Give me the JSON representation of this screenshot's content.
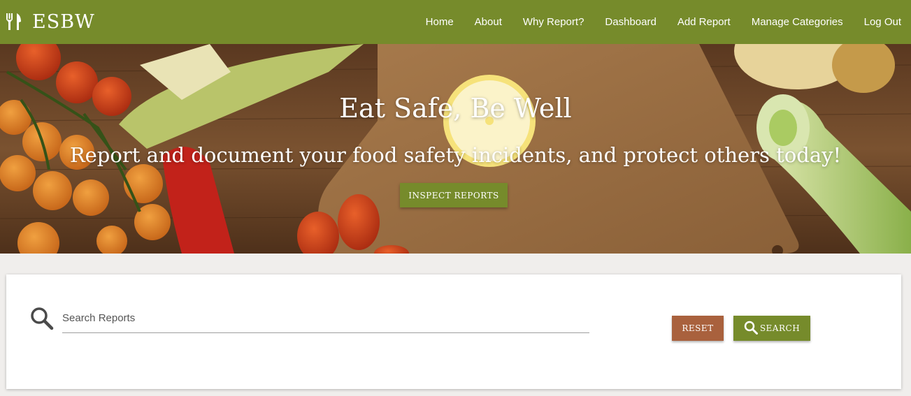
{
  "brand": {
    "name": "ESBW",
    "icon": "fork-knife-icon"
  },
  "nav": {
    "items": [
      {
        "label": "Home"
      },
      {
        "label": "About"
      },
      {
        "label": "Why Report?"
      },
      {
        "label": "Dashboard"
      },
      {
        "label": "Add Report"
      },
      {
        "label": "Manage Categories"
      },
      {
        "label": "Log Out"
      }
    ]
  },
  "hero": {
    "title": "Eat Safe, Be Well",
    "subtitle": "Report and document your food safety incidents, and protect others today!",
    "button_label": "INSPECT REPORTS"
  },
  "search": {
    "placeholder": "Search Reports",
    "value": "",
    "reset_label": "RESET",
    "search_label": "SEARCH",
    "icon": "search-icon"
  },
  "colors": {
    "primary": "#768b2b",
    "accent": "#a9613d",
    "page_background": "#f0eeec"
  }
}
